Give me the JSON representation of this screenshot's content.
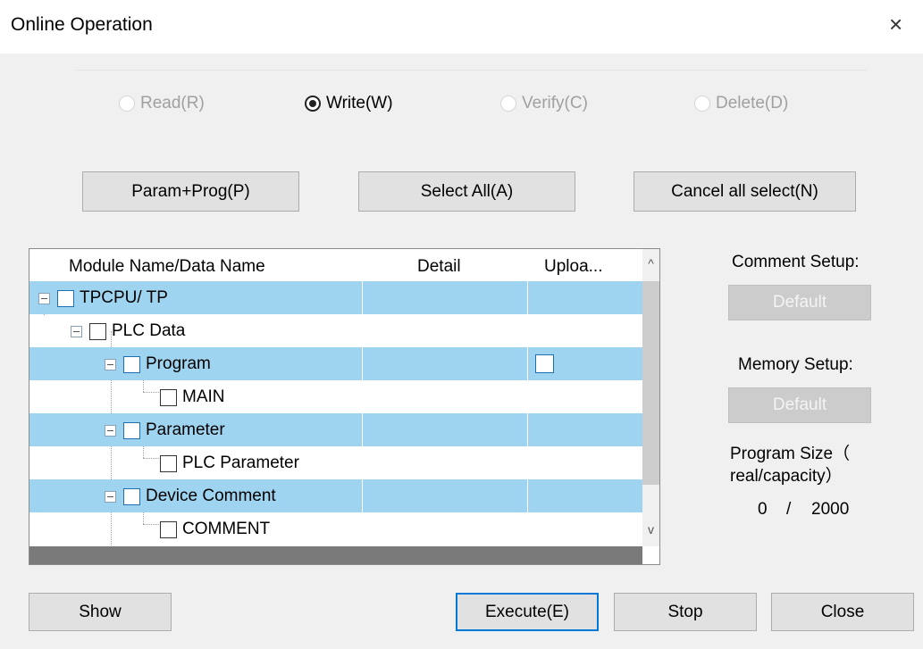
{
  "window": {
    "title": "Online Operation",
    "close_glyph": "×"
  },
  "modes": [
    {
      "label": "Read(R)",
      "checked": false,
      "enabled": false
    },
    {
      "label": "Write(W)",
      "checked": true,
      "enabled": true
    },
    {
      "label": "Verify(C)",
      "checked": false,
      "enabled": false
    },
    {
      "label": "Delete(D)",
      "checked": false,
      "enabled": false
    }
  ],
  "selection_buttons": {
    "param_prog": "Param+Prog(P)",
    "select_all": "Select All(A)",
    "cancel_all": "Cancel all select(N)"
  },
  "tree": {
    "columns": [
      "Module Name/Data Name",
      "Detail",
      "Uploa..."
    ],
    "rows": [
      {
        "label": "TPCPU/ TP",
        "highlighted": true
      },
      {
        "label": "PLC Data",
        "highlighted": false
      },
      {
        "label": "Program",
        "highlighted": true,
        "upload_checkbox": true
      },
      {
        "label": "MAIN",
        "highlighted": false
      },
      {
        "label": "Parameter",
        "highlighted": true
      },
      {
        "label": "PLC Parameter",
        "highlighted": false
      },
      {
        "label": "Device Comment",
        "highlighted": true
      },
      {
        "label": "COMMENT",
        "highlighted": false
      }
    ],
    "scroll_up_glyph": "^",
    "scroll_down_glyph": "v"
  },
  "side": {
    "comment_setup_label": "Comment Setup:",
    "comment_default_button": "Default",
    "memory_setup_label": "Memory Setup:",
    "memory_default_button": "Default",
    "program_size_label_1": "Program Size（",
    "program_size_label_2": "real/capacity）",
    "program_size_real": "0",
    "program_size_sep": "/",
    "program_size_capacity": "2000"
  },
  "footer": {
    "show": "Show",
    "execute": "Execute(E)",
    "stop": "Stop",
    "close": "Close"
  },
  "colors": {
    "row_highlight": "#9fd4f0",
    "focus_border": "#0078d7",
    "dialog_bg": "#f0f0f0"
  }
}
